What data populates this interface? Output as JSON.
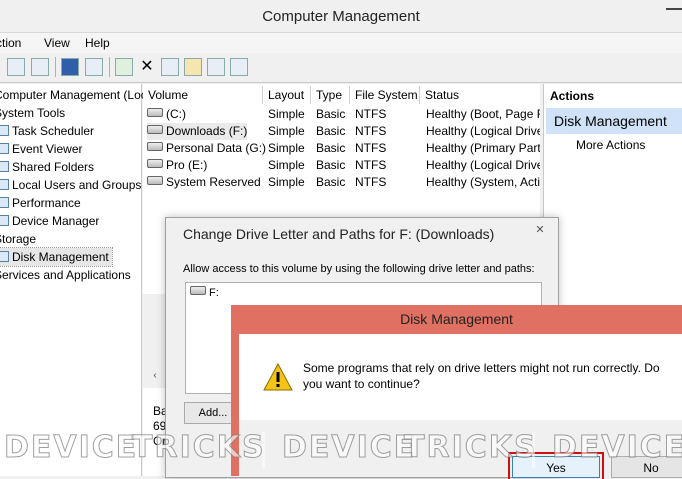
{
  "window": {
    "title": "Computer Management"
  },
  "menu": [
    "Action",
    "View",
    "Help"
  ],
  "tree": [
    {
      "label": "Computer Management (Local",
      "indent": 0,
      "icon": false
    },
    {
      "label": "System Tools",
      "indent": 0,
      "icon": false
    },
    {
      "label": "Task Scheduler",
      "indent": 1,
      "icon": true
    },
    {
      "label": "Event Viewer",
      "indent": 1,
      "icon": true
    },
    {
      "label": "Shared Folders",
      "indent": 1,
      "icon": true
    },
    {
      "label": "Local Users and Groups",
      "indent": 1,
      "icon": true
    },
    {
      "label": "Performance",
      "indent": 1,
      "icon": true
    },
    {
      "label": "Device Manager",
      "indent": 1,
      "icon": true
    },
    {
      "label": "Storage",
      "indent": 0,
      "icon": false
    },
    {
      "label": "Disk Management",
      "indent": 1,
      "icon": true
    },
    {
      "label": "Services and Applications",
      "indent": 0,
      "icon": false
    }
  ],
  "volumes": {
    "columns": [
      "Volume",
      "Layout",
      "Type",
      "File System",
      "Status"
    ],
    "rows": [
      [
        "(C:)",
        "Simple",
        "Basic",
        "NTFS",
        "Healthy (Boot, Page F"
      ],
      [
        "Downloads (F:)",
        "Simple",
        "Basic",
        "NTFS",
        "Healthy (Logical Drive"
      ],
      [
        "Personal Data (G:)",
        "Simple",
        "Basic",
        "NTFS",
        "Healthy (Primary Part"
      ],
      [
        "Pro (E:)",
        "Simple",
        "Basic",
        "NTFS",
        "Healthy (Logical Drive"
      ],
      [
        "System Reserved",
        "Simple",
        "Basic",
        "NTFS",
        "Healthy (System, Acti"
      ]
    ],
    "bottom_fragments": [
      "Ba",
      "69",
      "Or"
    ]
  },
  "actions": {
    "header": "Actions",
    "selected": "Disk Management",
    "more": "More Actions"
  },
  "change_dialog": {
    "title": "Change Drive Letter and Paths for F: (Downloads)",
    "close": "✕",
    "description": "Allow access to this volume by using the following drive letter and paths:",
    "entry": "F:",
    "add_label": "Add..."
  },
  "confirm_dialog": {
    "title": "Disk Management",
    "message": "Some programs that rely on drive letters might not run correctly. Do you want to continue?",
    "yes_label": "Yes",
    "no_label": "No"
  },
  "watermark": [
    "DEVICE",
    "TRICKS",
    "DEVICE",
    "TRICKS",
    "DEVICE"
  ],
  "colors": {
    "confirm_border": "#e07062",
    "selection": "#cfe2f7",
    "highlight_box": "#d01010"
  }
}
